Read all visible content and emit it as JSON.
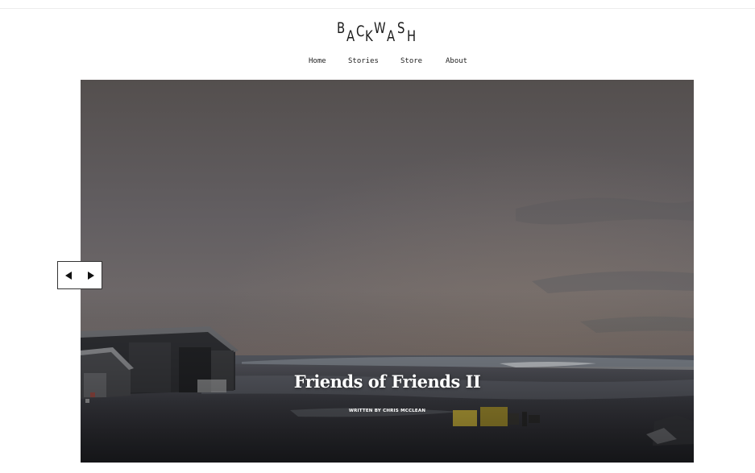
{
  "brand": {
    "logo_letters": [
      "B",
      "A",
      "C",
      "K",
      "W",
      "A",
      "S",
      "H"
    ]
  },
  "nav": {
    "items": [
      {
        "label": "Home"
      },
      {
        "label": "Stories"
      },
      {
        "label": "Store"
      },
      {
        "label": "About"
      }
    ]
  },
  "hero": {
    "title": "Friends of Friends II",
    "byline": "WRITTEN BY CHRIS MCCLEAN"
  },
  "slider": {
    "prev_icon": "triangle-left-icon",
    "next_icon": "triangle-right-icon"
  },
  "colors": {
    "text": "#1b1b1b",
    "hero_overlay_text": "#ffffff",
    "rule": "#ececec"
  }
}
